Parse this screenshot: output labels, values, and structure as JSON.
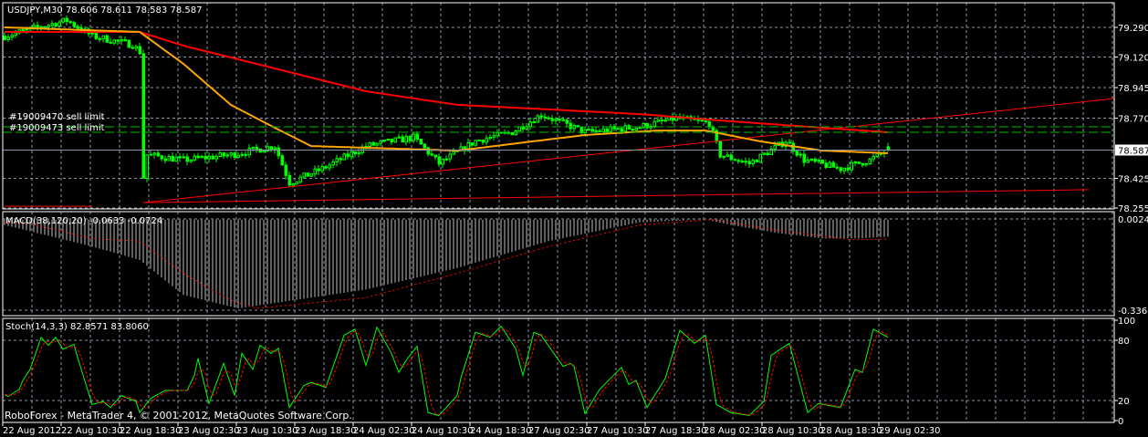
{
  "colors": {
    "background": "#000000",
    "grid": "#8a94a6",
    "frame": "#ffffff",
    "candle": "#00ff00",
    "ma_fast": "#ffa500",
    "ma_slow": "#ff0000",
    "trendline": "#ff0000",
    "order_line": "#00c000",
    "bid_line": "#8a94a6",
    "macd_hist": "#c0c0c0",
    "macd_signal": "#ff0000",
    "stoch_main": "#00ff00",
    "stoch_signal": "#ff0000"
  },
  "footer": "RoboForex - MetaTrader 4, © 2001-2012, MetaQuotes Software Corp.",
  "chart_data": [
    {
      "type": "candlestick",
      "title": "USDJPY,M30  78.606 78.611 78.583 78.587",
      "symbol": "USDJPY",
      "timeframe": "M30",
      "ohlc_last": {
        "open": 78.606,
        "high": 78.611,
        "low": 78.583,
        "close": 78.587
      },
      "ylim": [
        78.255,
        79.29
      ],
      "y_ticks": [
        "79.290",
        "79.120",
        "78.945",
        "78.770",
        "78.425",
        "78.255"
      ],
      "bid_label": "78.587",
      "bars_per_tick_label": 16,
      "x_tick_labels": [
        "22 Aug 2012",
        "22 Aug 10:30",
        "22 Aug 18:30",
        "23 Aug 02:30",
        "23 Aug 10:30",
        "23 Aug 18:30",
        "24 Aug 02:30",
        "24 Aug 10:30",
        "24 Aug 18:30",
        "27 Aug 02:30",
        "27 Aug 10:30",
        "27 Aug 18:30",
        "28 Aug 02:30",
        "28 Aug 10:30",
        "28 Aug 18:30",
        "29 Aug 02:30"
      ],
      "close_keypoints": [
        [
          0,
          79.24
        ],
        [
          9,
          79.29
        ],
        [
          17,
          79.33
        ],
        [
          24,
          79.24
        ],
        [
          35,
          79.19
        ],
        [
          37,
          79.15
        ],
        [
          38,
          78.43
        ],
        [
          39,
          78.56
        ],
        [
          49,
          78.53
        ],
        [
          62,
          78.56
        ],
        [
          74,
          78.61
        ],
        [
          78,
          78.4
        ],
        [
          87,
          78.48
        ],
        [
          99,
          78.61
        ],
        [
          112,
          78.66
        ],
        [
          119,
          78.51
        ],
        [
          129,
          78.64
        ],
        [
          139,
          78.69
        ],
        [
          147,
          78.79
        ],
        [
          159,
          78.69
        ],
        [
          174,
          78.72
        ],
        [
          184,
          78.77
        ],
        [
          193,
          78.74
        ],
        [
          196,
          78.56
        ],
        [
          204,
          78.51
        ],
        [
          214,
          78.64
        ],
        [
          219,
          78.53
        ],
        [
          229,
          78.48
        ],
        [
          237,
          78.53
        ],
        [
          242,
          78.587
        ]
      ],
      "ma_fast": [
        [
          0,
          79.29
        ],
        [
          37,
          79.264
        ],
        [
          49,
          79.081
        ],
        [
          62,
          78.846
        ],
        [
          74,
          78.715
        ],
        [
          84,
          78.61
        ],
        [
          124,
          78.584
        ],
        [
          159,
          78.673
        ],
        [
          179,
          78.699
        ],
        [
          192,
          78.699
        ],
        [
          207,
          78.637
        ],
        [
          224,
          78.584
        ],
        [
          242,
          78.569
        ]
      ],
      "ma_slow": [
        [
          0,
          79.264
        ],
        [
          37,
          79.264
        ],
        [
          49,
          79.185
        ],
        [
          74,
          79.055
        ],
        [
          99,
          78.924
        ],
        [
          124,
          78.846
        ],
        [
          149,
          78.82
        ],
        [
          174,
          78.793
        ],
        [
          199,
          78.752
        ],
        [
          224,
          78.715
        ],
        [
          242,
          78.689
        ]
      ],
      "trendlines": [
        [
          [
            38,
            78.286
          ],
          [
            304,
            78.882
          ]
        ],
        [
          [
            38,
            78.286
          ],
          [
            297,
            78.36
          ]
        ],
        [
          [
            0,
            78.265
          ],
          [
            24,
            78.265
          ]
        ]
      ],
      "orders": [
        {
          "label": "#19009470 sell limit",
          "price": 78.72
        },
        {
          "label": "#19009473 sell limit",
          "price": 78.689
        }
      ]
    },
    {
      "type": "bar",
      "title": "MACD(38,120,20) -0.0633 -0.0724",
      "ylim": [
        -0.3366,
        0.0024
      ],
      "y_ticks": [
        "0.0024",
        "-0.3366"
      ],
      "histogram_keypoints": [
        [
          0,
          -0.02
        ],
        [
          12,
          -0.06
        ],
        [
          24,
          -0.1
        ],
        [
          37,
          -0.15
        ],
        [
          49,
          -0.28
        ],
        [
          64,
          -0.33
        ],
        [
          74,
          -0.31
        ],
        [
          99,
          -0.26
        ],
        [
          124,
          -0.18
        ],
        [
          149,
          -0.08
        ],
        [
          174,
          -0.01
        ],
        [
          192,
          0.0
        ],
        [
          199,
          -0.02
        ],
        [
          212,
          -0.05
        ],
        [
          224,
          -0.07
        ],
        [
          234,
          -0.07
        ],
        [
          242,
          -0.0633
        ]
      ],
      "signal_keypoints": [
        [
          0,
          -0.01
        ],
        [
          7,
          -0.015
        ],
        [
          24,
          -0.07
        ],
        [
          37,
          -0.08
        ],
        [
          49,
          -0.2
        ],
        [
          62,
          -0.3
        ],
        [
          69,
          -0.33
        ],
        [
          99,
          -0.29
        ],
        [
          124,
          -0.2
        ],
        [
          149,
          -0.1
        ],
        [
          174,
          -0.02
        ],
        [
          194,
          0.0
        ],
        [
          212,
          -0.04
        ],
        [
          232,
          -0.075
        ],
        [
          242,
          -0.0724
        ]
      ]
    },
    {
      "type": "line",
      "title": "Stoch(14,3,3) 82.8571 83.8060",
      "ylim": [
        0,
        100
      ],
      "y_ticks": [
        "100",
        "80",
        "20",
        "0"
      ],
      "main": [
        [
          0,
          26
        ],
        [
          1,
          24
        ],
        [
          4,
          31
        ],
        [
          5,
          40
        ],
        [
          7,
          51
        ],
        [
          9,
          72
        ],
        [
          10,
          83
        ],
        [
          12,
          75
        ],
        [
          14,
          83
        ],
        [
          16,
          71
        ],
        [
          19,
          76
        ],
        [
          20,
          63
        ],
        [
          24,
          16
        ],
        [
          27,
          19
        ],
        [
          29,
          13
        ],
        [
          32,
          25
        ],
        [
          36,
          19
        ],
        [
          37,
          8
        ],
        [
          40,
          22
        ],
        [
          44,
          30
        ],
        [
          50,
          30
        ],
        [
          52,
          45
        ],
        [
          53,
          62
        ],
        [
          56,
          17
        ],
        [
          60,
          57
        ],
        [
          63,
          25
        ],
        [
          65,
          67
        ],
        [
          68,
          51
        ],
        [
          70,
          75
        ],
        [
          73,
          67
        ],
        [
          75,
          72
        ],
        [
          78,
          13
        ],
        [
          82,
          35
        ],
        [
          84,
          38
        ],
        [
          88,
          33
        ],
        [
          93,
          85
        ],
        [
          96,
          91
        ],
        [
          99,
          55
        ],
        [
          102,
          93
        ],
        [
          106,
          67
        ],
        [
          108,
          48
        ],
        [
          110,
          60
        ],
        [
          113,
          74
        ],
        [
          116,
          8
        ],
        [
          119,
          5
        ],
        [
          124,
          25
        ],
        [
          124,
          31
        ],
        [
          129,
          88
        ],
        [
          133,
          83
        ],
        [
          136,
          94
        ],
        [
          140,
          72
        ],
        [
          142,
          45
        ],
        [
          145,
          88
        ],
        [
          147,
          85
        ],
        [
          153,
          54
        ],
        [
          155,
          57
        ],
        [
          156,
          54
        ],
        [
          159,
          7
        ],
        [
          163,
          31
        ],
        [
          169,
          53
        ],
        [
          171,
          36
        ],
        [
          173,
          40
        ],
        [
          176,
          13
        ],
        [
          181,
          42
        ],
        [
          185,
          90
        ],
        [
          189,
          77
        ],
        [
          192,
          85
        ],
        [
          195,
          16
        ],
        [
          199,
          8
        ],
        [
          204,
          5
        ],
        [
          208,
          19
        ],
        [
          210,
          65
        ],
        [
          215,
          77
        ],
        [
          220,
          8
        ],
        [
          223,
          17
        ],
        [
          229,
          13
        ],
        [
          233,
          51
        ],
        [
          235,
          48
        ],
        [
          238,
          91
        ],
        [
          242,
          83
        ]
      ],
      "signal_lag_bars": 2
    }
  ]
}
